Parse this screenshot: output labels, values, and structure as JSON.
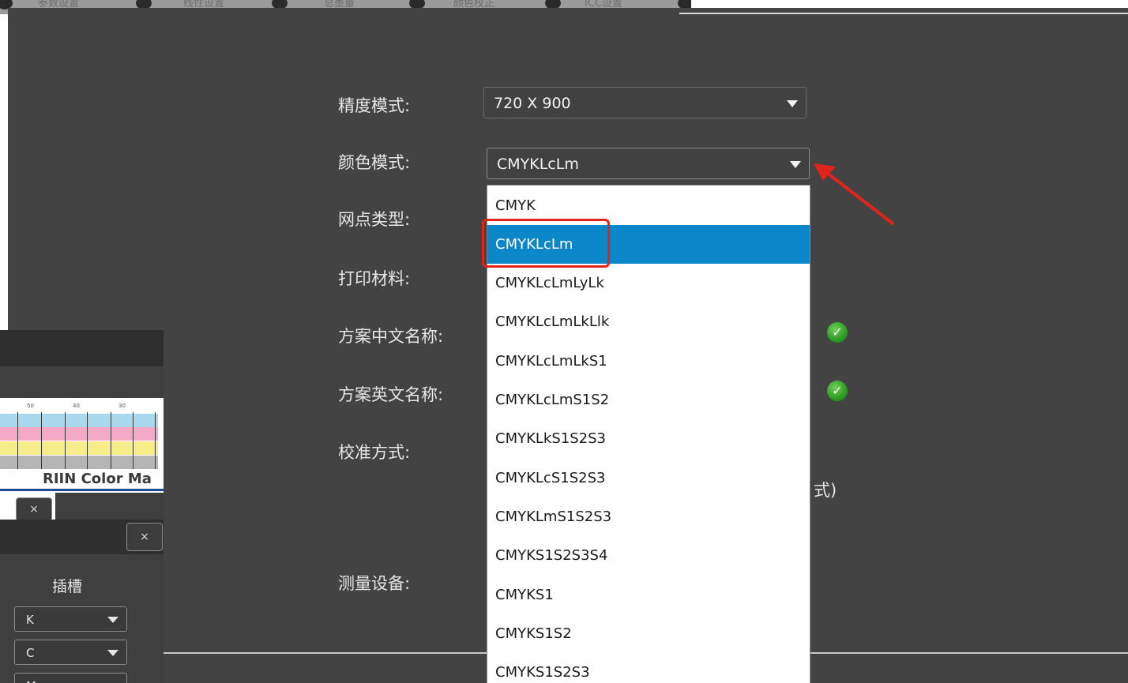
{
  "tabs": [
    {
      "label": "参数设置"
    },
    {
      "label": "线性设置"
    },
    {
      "label": "总墨量"
    },
    {
      "label": "颜色校正"
    },
    {
      "label": "ICC设置"
    }
  ],
  "form": {
    "precision_label": "精度模式:",
    "precision_value": "720 X 900",
    "color_mode_label": "颜色模式:",
    "color_mode_value": "CMYKLcLm",
    "dot_type_label": "网点类型:",
    "print_material_label": "打印材料:",
    "scheme_cn_label": "方案中文名称:",
    "scheme_en_label": "方案英文名称:",
    "calibration_label": "校准方式:",
    "calibration_partial": "式)",
    "measure_device_label": "测量设备:"
  },
  "color_mode_options": [
    "CMYK",
    "CMYKLcLm",
    "CMYKLcLmLyLk",
    "CMYKLcLmLkLlk",
    "CMYKLcLmLkS1",
    "CMYKLcLmS1S2",
    "CMYKLkS1S2S3",
    "CMYKLcS1S2S3",
    "CMYKLmS1S2S3",
    "CMYKS1S2S3S4",
    "CMYKS1",
    "CMYKS1S2",
    "CMYKS1S2S3"
  ],
  "selected_option_index": 1,
  "left_window": {
    "chart_ticks": [
      "50",
      "40",
      "30"
    ],
    "brand_text": "RIIN Color Ma",
    "close_symbol": "×",
    "slot_heading": "插槽",
    "slots": [
      "K",
      "C",
      "M"
    ]
  },
  "icons": {
    "check_icon": "check-circle-icon",
    "caret_icon": "caret-down-icon",
    "arrow": "red-annotation-arrow"
  },
  "colors": {
    "panel_bg": "#434343",
    "selection_bg": "#0a86c9",
    "annotation_red": "#e2231a",
    "check_green": "#2c9a22"
  }
}
